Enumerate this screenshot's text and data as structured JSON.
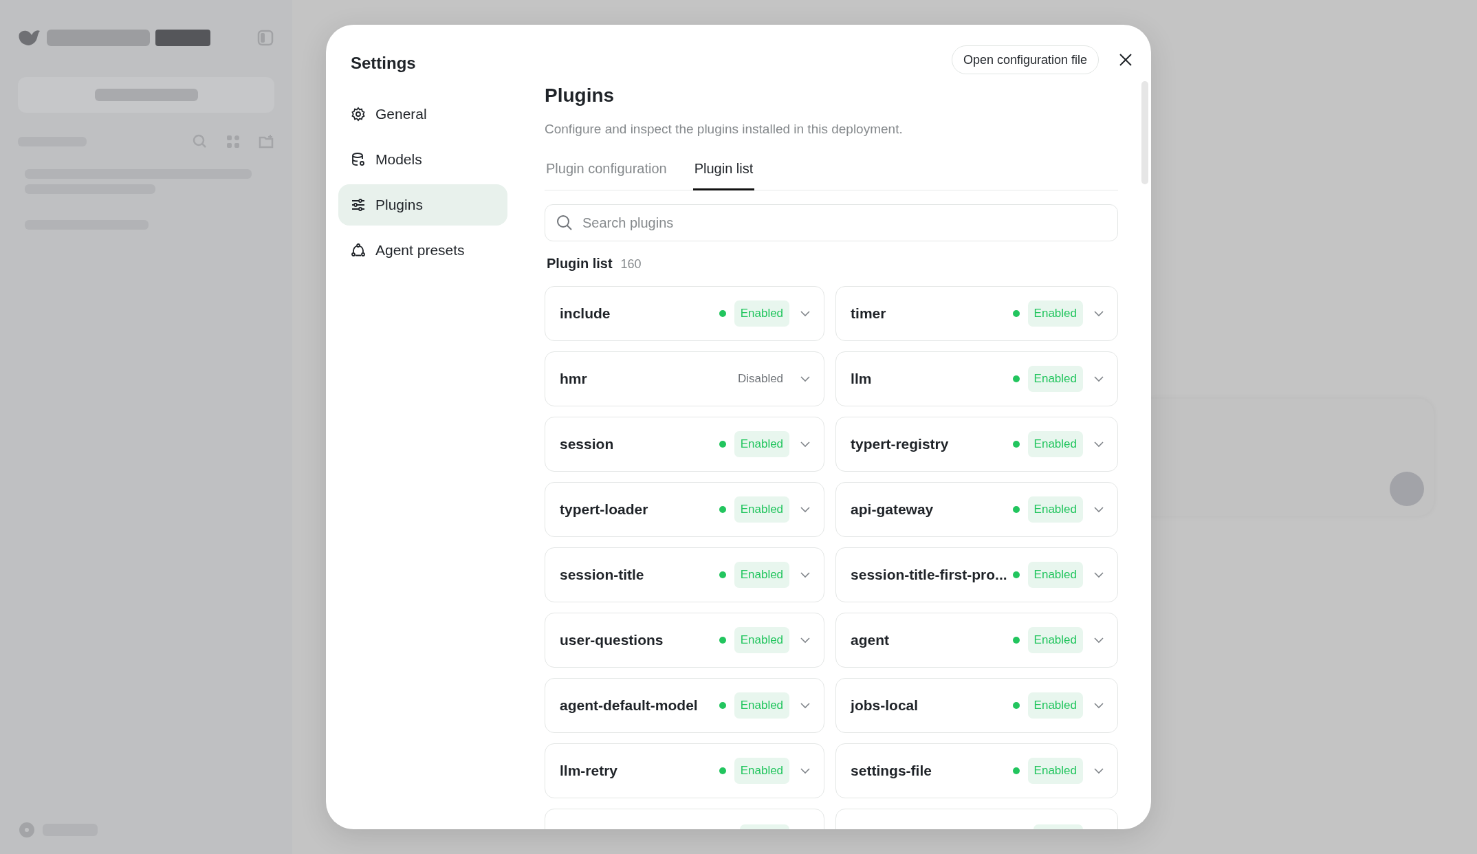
{
  "settings": {
    "title": "Settings",
    "nav": [
      {
        "label": "General",
        "selected": false
      },
      {
        "label": "Models",
        "selected": false
      },
      {
        "label": "Plugins",
        "selected": true
      },
      {
        "label": "Agent presets",
        "selected": false
      }
    ],
    "open_config_button": "Open configuration file",
    "page": {
      "title": "Plugins",
      "description": "Configure and inspect the plugins installed in this deployment.",
      "tabs": [
        {
          "label": "Plugin configuration",
          "selected": false
        },
        {
          "label": "Plugin list",
          "selected": true
        }
      ],
      "search": {
        "placeholder": "Search plugins"
      },
      "list_title": "Plugin list",
      "count": "160",
      "plugins": [
        {
          "name": "include",
          "enabled": true,
          "status": "Enabled"
        },
        {
          "name": "timer",
          "enabled": true,
          "status": "Enabled"
        },
        {
          "name": "hmr",
          "enabled": false,
          "status": "Disabled"
        },
        {
          "name": "llm",
          "enabled": true,
          "status": "Enabled"
        },
        {
          "name": "session",
          "enabled": true,
          "status": "Enabled"
        },
        {
          "name": "typert-registry",
          "enabled": true,
          "status": "Enabled"
        },
        {
          "name": "typert-loader",
          "enabled": true,
          "status": "Enabled"
        },
        {
          "name": "api-gateway",
          "enabled": true,
          "status": "Enabled"
        },
        {
          "name": "session-title",
          "enabled": true,
          "status": "Enabled"
        },
        {
          "name": "session-title-first-pro...",
          "enabled": true,
          "status": "Enabled"
        },
        {
          "name": "user-questions",
          "enabled": true,
          "status": "Enabled"
        },
        {
          "name": "agent",
          "enabled": true,
          "status": "Enabled"
        },
        {
          "name": "agent-default-model",
          "enabled": true,
          "status": "Enabled"
        },
        {
          "name": "jobs-local",
          "enabled": true,
          "status": "Enabled"
        },
        {
          "name": "llm-retry",
          "enabled": true,
          "status": "Enabled"
        },
        {
          "name": "settings-file",
          "enabled": true,
          "status": "Enabled"
        }
      ],
      "partial_plugins": [
        {
          "enabled": true
        },
        {
          "enabled": true
        }
      ]
    }
  }
}
